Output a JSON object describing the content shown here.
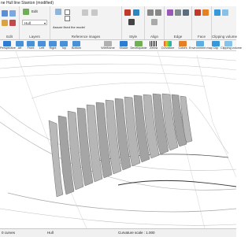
{
  "window": {
    "title": "ne Hull line Stanton (modified)"
  },
  "ribbon": {
    "edit": {
      "label": "Edit"
    },
    "layers": {
      "label": "Layers",
      "current_layer": "Hull",
      "edit_label": "Edit"
    },
    "reference_images": {
      "label": "Reference images",
      "align_label": "Assure fixed the model"
    },
    "style": {
      "label": "Style"
    },
    "align": {
      "label": "Align"
    },
    "edge": {
      "label": "Edge"
    },
    "face": {
      "label": "Face"
    },
    "clipping": {
      "label": "Clipping volume"
    }
  },
  "views": [
    {
      "label": "Perspective"
    },
    {
      "label": "Aft"
    },
    {
      "label": "Front"
    },
    {
      "label": "Left"
    },
    {
      "label": "Right"
    },
    {
      "label": "Top"
    },
    {
      "label": "Bottom"
    },
    {
      "label": "Wireframe"
    },
    {
      "label": "Shade"
    },
    {
      "label": "Developable"
    },
    {
      "label": "Zebra"
    },
    {
      "label": "Curvature"
    },
    {
      "label": "Colors"
    },
    {
      "label": "Environment map"
    },
    {
      "label": "Clip"
    },
    {
      "label": "Clipping volume"
    }
  ],
  "status": {
    "selection": "0 curves",
    "layer": "Hull",
    "curvature": "Curvature scale : 1.000"
  },
  "colors": {
    "accent": "#2b7cd3",
    "section_fill": "#a9a9a9",
    "section_edge": "#6e6e6e",
    "wire": "#9a9a9a"
  }
}
